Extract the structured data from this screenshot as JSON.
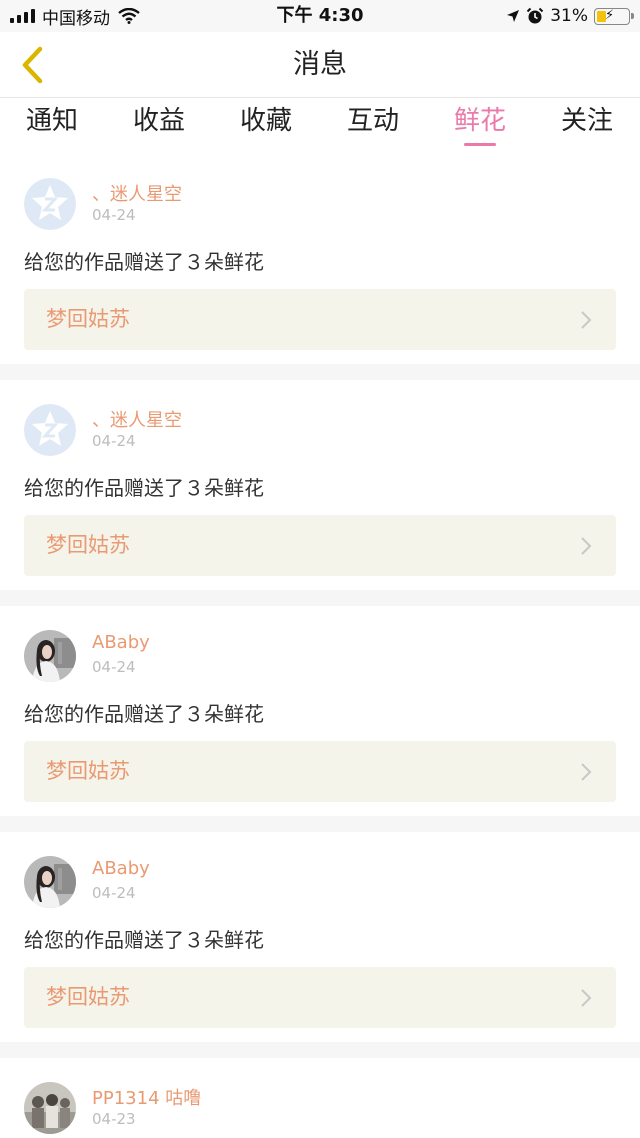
{
  "status_bar": {
    "carrier": "中国移动",
    "time": "下午 4:30",
    "battery_percent": "31%",
    "icons": [
      "signal-icon",
      "wifi-icon",
      "location-icon",
      "alarm-icon",
      "battery-icon"
    ]
  },
  "nav": {
    "title": "消息",
    "back_icon": "chevron-left-icon"
  },
  "tabs": [
    {
      "label": "通知",
      "active": false
    },
    {
      "label": "收益",
      "active": false
    },
    {
      "label": "收藏",
      "active": false
    },
    {
      "label": "互动",
      "active": false
    },
    {
      "label": "鲜花",
      "active": true
    },
    {
      "label": "关注",
      "active": false
    }
  ],
  "messages": [
    {
      "name": "、迷人星空",
      "date": "04-24",
      "text": "给您的作品赠送了３朵鲜花",
      "work": "梦回姑苏",
      "avatar": "default-star-avatar"
    },
    {
      "name": "、迷人星空",
      "date": "04-24",
      "text": "给您的作品赠送了３朵鲜花",
      "work": "梦回姑苏",
      "avatar": "default-star-avatar"
    },
    {
      "name": "ABaby",
      "date": "04-24",
      "text": "给您的作品赠送了３朵鲜花",
      "work": "梦回姑苏",
      "avatar": "photo-avatar"
    },
    {
      "name": "ABaby",
      "date": "04-24",
      "text": "给您的作品赠送了３朵鲜花",
      "work": "梦回姑苏",
      "avatar": "photo-avatar"
    },
    {
      "name": "PP1314 咕噜",
      "date": "04-23",
      "text": "",
      "work": "",
      "avatar": "photo-avatar"
    }
  ],
  "colors": {
    "accent_pink": "#e97aa9",
    "name_orange": "#ea9a73",
    "back_arrow_yellow": "#d9b700",
    "link_background": "#f4f4ea"
  }
}
